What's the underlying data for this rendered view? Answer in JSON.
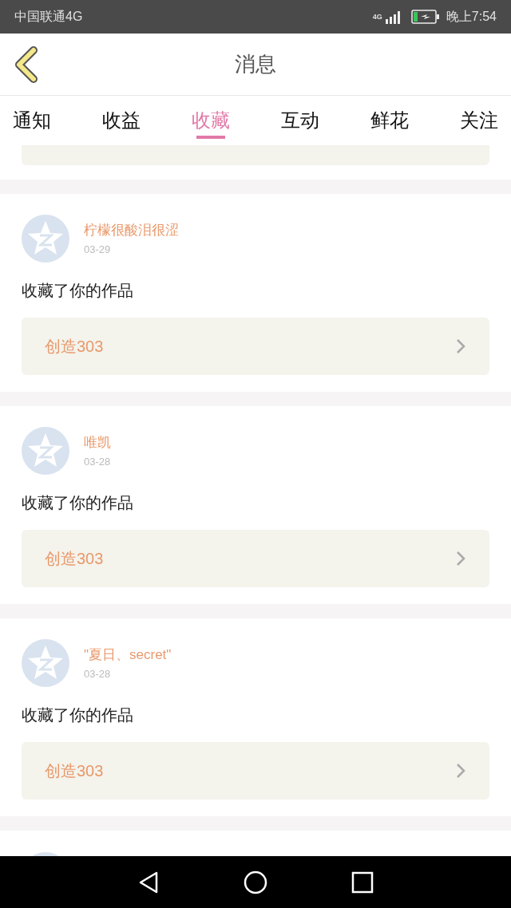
{
  "status_bar": {
    "carrier": "中国联通4G",
    "network": "4G",
    "time": "晚上7:54"
  },
  "header": {
    "title": "消息"
  },
  "tabs": [
    {
      "label": "通知",
      "selected": false
    },
    {
      "label": "收益",
      "selected": false
    },
    {
      "label": "收藏",
      "selected": true
    },
    {
      "label": "互动",
      "selected": false
    },
    {
      "label": "鲜花",
      "selected": false
    },
    {
      "label": "关注",
      "selected": false
    }
  ],
  "items": [
    {
      "name": "柠檬很酸泪很涩",
      "date": "03-29",
      "action": "收藏了你的作品",
      "work": "创造303"
    },
    {
      "name": "唯凯",
      "date": "03-28",
      "action": "收藏了你的作品",
      "work": "创造303"
    },
    {
      "name": "\"夏日、secret\"",
      "date": "03-28",
      "action": "收藏了你的作品",
      "work": "创造303"
    }
  ]
}
